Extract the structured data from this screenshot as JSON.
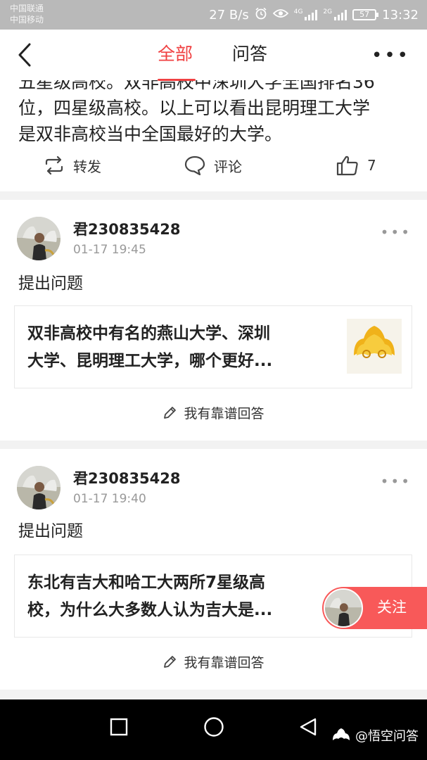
{
  "status_bar": {
    "carrier_1": "中国联通",
    "carrier_2": "中国移动",
    "speed": "27 B/s",
    "net_1": "4G",
    "net_2": "2G",
    "battery": "57",
    "time": "13:32"
  },
  "header": {
    "tabs": [
      {
        "label": "全部",
        "active": true
      },
      {
        "label": "问答",
        "active": false
      }
    ],
    "accent_color": "#f04142"
  },
  "top_post": {
    "lines": [
      "五星级高校。双非高校中深圳大学全国排名36",
      "位，四星级高校。以上可以看出昆明理工大学",
      "是双非高校当中全国最好的大学。"
    ],
    "actions": {
      "repost": "转发",
      "comment": "评论",
      "like_count": "7"
    }
  },
  "cards": [
    {
      "username": "君230835428",
      "time": "01-17 19:45",
      "action": "提出问题",
      "question_lines": [
        "双非高校中有名的燕山大学、深圳",
        "大学、昆明理工大学，哪个更好..."
      ],
      "answer_label": "我有靠谱回答"
    },
    {
      "username": "君230835428",
      "time": "01-17 19:40",
      "action": "提出问题",
      "question_lines": [
        "东北有吉大和哈工大两所7星级高",
        "校，为什么大多数人认为吉大是..."
      ],
      "answer_label": "我有靠谱回答"
    }
  ],
  "follow": {
    "label": "关注",
    "color": "#f85959"
  },
  "watermark": {
    "text": "@悟空问答"
  }
}
